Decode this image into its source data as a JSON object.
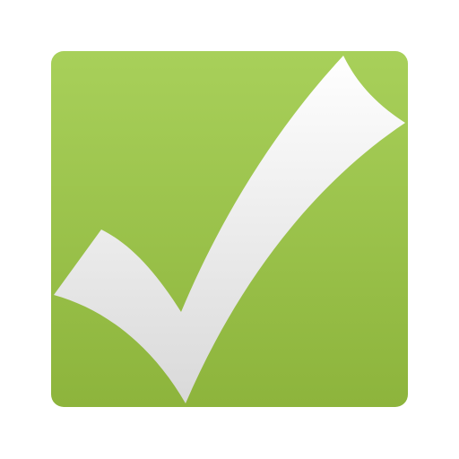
{
  "icon": {
    "name": "checkmark-icon",
    "colors": {
      "tile_top": "#a8d05a",
      "tile_bottom": "#8db43c",
      "check_top": "#ffffff",
      "check_bottom": "#d9d9d9"
    }
  }
}
